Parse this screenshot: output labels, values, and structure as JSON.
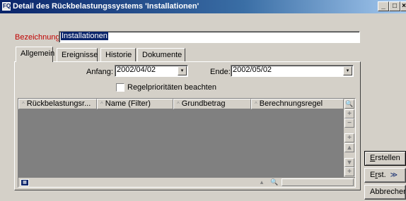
{
  "window": {
    "title": "Detail des Rückbelastungssystems 'Installationen'",
    "app_icon": "FQ",
    "controls": {
      "minimize": "_",
      "maximize": "□",
      "close": "×"
    }
  },
  "form": {
    "name_label": "Bezeichnung:",
    "name_value": "Installationen"
  },
  "tabs": [
    {
      "label": "Allgemein",
      "active": true
    },
    {
      "label": "Ereignisse",
      "active": false
    },
    {
      "label": "Historie",
      "active": false
    },
    {
      "label": "Dokumente",
      "active": false
    }
  ],
  "general": {
    "start_label": "Anfang:",
    "start_value": "2002/04/02",
    "end_label": "Ende:",
    "end_value": "2002/05/02",
    "priority_checkbox_label": "Regelprioritäten beachten",
    "priority_checked": false
  },
  "table": {
    "columns": [
      "Rückbelastungsr...",
      "Name (Filter)",
      "Grundbetrag",
      "Berechnungsregel"
    ],
    "rows": []
  },
  "buttons": {
    "create_prefix": "E",
    "create_rest": "rstellen",
    "create_ext_prefix": "E",
    "create_ext_underlined": "r",
    "create_ext_rest": "st.",
    "create_ext_icon": "≫",
    "cancel": "Abbrechen"
  },
  "icons": {
    "combo": "▾",
    "sort": "^",
    "search": "🔍",
    "add": "+",
    "remove": "−",
    "up": "▴",
    "down": "▾",
    "grid": "▦"
  }
}
